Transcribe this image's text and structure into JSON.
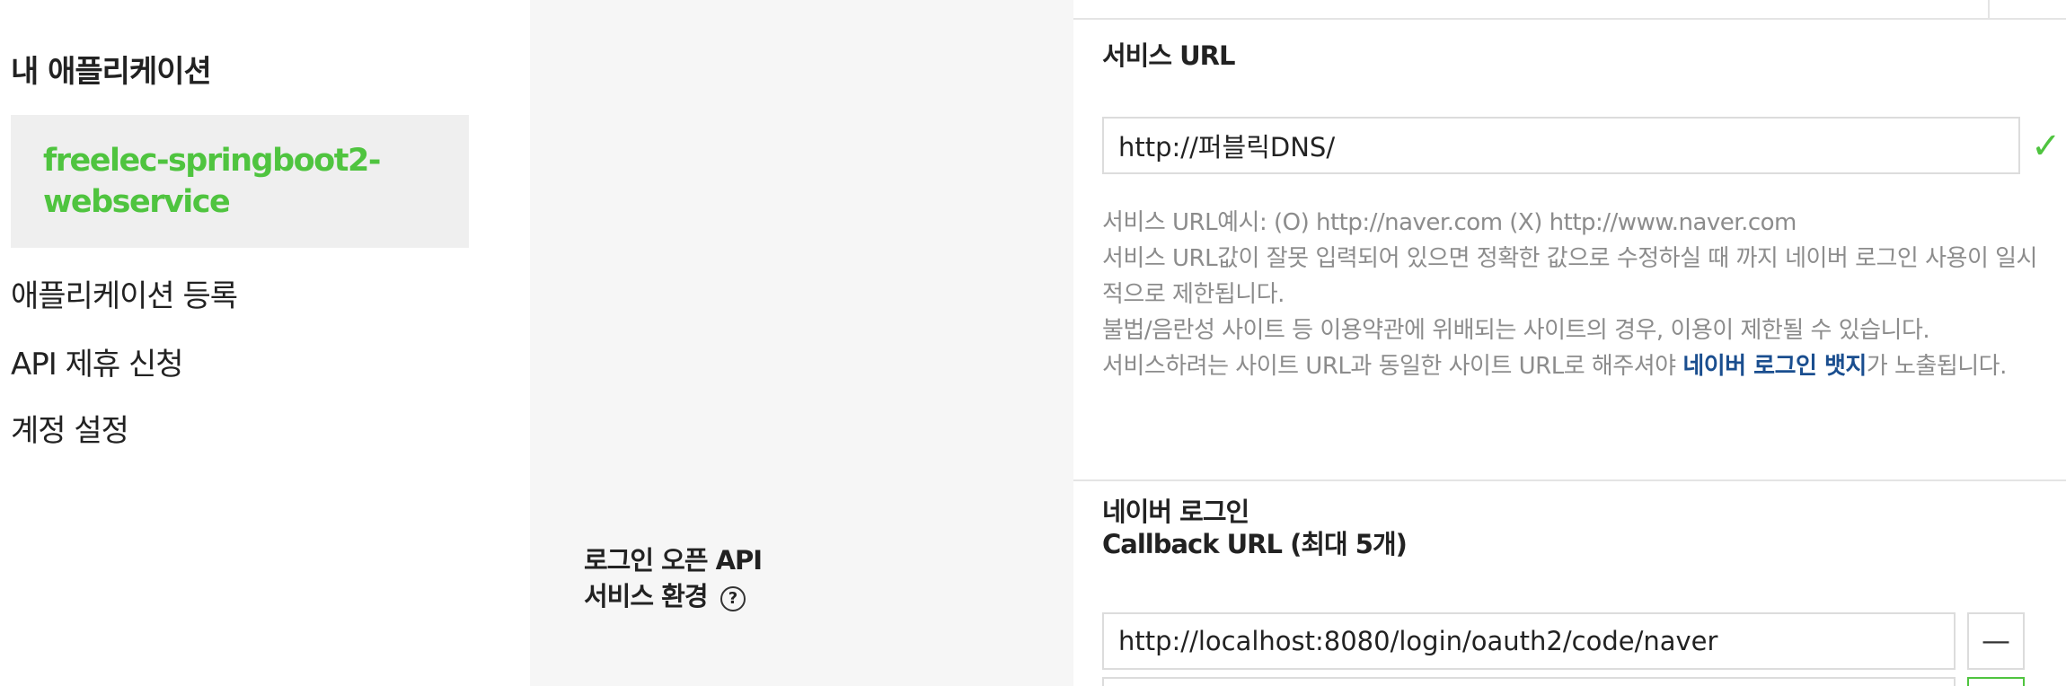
{
  "sidebar": {
    "title": "내 애플리케이션",
    "selected_app": "freelec-springboot2-webservice",
    "menu": [
      {
        "label": "애플리케이션 등록"
      },
      {
        "label": "API 제휴 신청"
      },
      {
        "label": "계정 설정"
      }
    ]
  },
  "section": {
    "label_line1": "로그인 오픈 API",
    "label_line2": "서비스 환경",
    "help_icon": "?"
  },
  "service_url": {
    "title": "서비스 URL",
    "value": "http://퍼블릭DNS/",
    "status_icon": "✓",
    "desc_line1": "서비스 URL예시: (O) http://naver.com (X) http://www.naver.com",
    "desc_line2": "서비스 URL값이 잘못 입력되어 있으면 정확한 값으로 수정하실 때 까지 네이버 로그인 사용이 일시적으로 제한됩니다.",
    "desc_line3": "불법/음란성 사이트 등 이용약관에 위배되는 사이트의 경우, 이용이 제한될 수 있습니다.",
    "desc_line4_pre": "서비스하려는 사이트 URL과 동일한 사이트 URL로 해주셔야 ",
    "desc_line4_link": "네이버 로그인 뱃지",
    "desc_line4_post": "가 노출됩니다."
  },
  "callback": {
    "title_line1": "네이버 로그인",
    "title_line2": "Callback URL (최대 5개)",
    "url1": "http://localhost:8080/login/oauth2/code/naver",
    "remove_label": "—"
  },
  "colors": {
    "accent_green": "#4fc43f",
    "link_blue": "#1a4e8f",
    "hint_gray": "#8c8c8c"
  }
}
